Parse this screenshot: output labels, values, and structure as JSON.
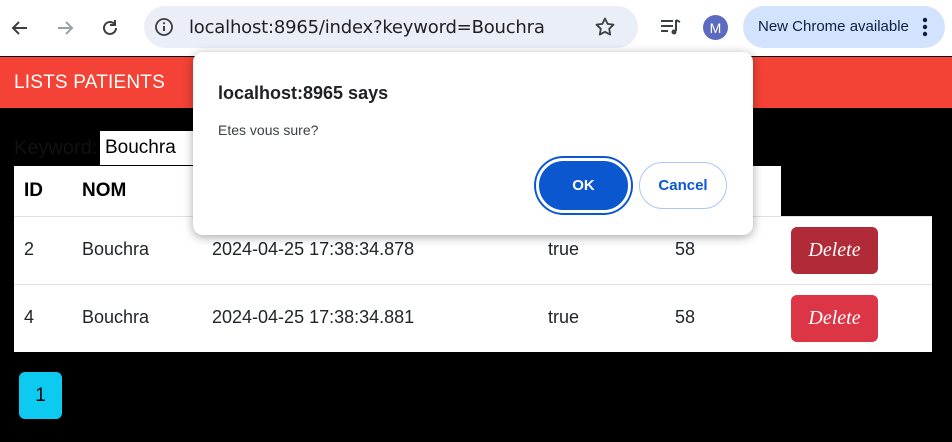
{
  "browser": {
    "url": "localhost:8965/index?keyword=Bouchra",
    "profile_initial": "M",
    "update_label": "New Chrome available"
  },
  "app": {
    "title": "LISTS PATIENTS"
  },
  "search": {
    "label": "Keyword:",
    "value": "Bouchra"
  },
  "table": {
    "headers": [
      "ID",
      "NOM"
    ],
    "rows": [
      {
        "id": "2",
        "nom": "Bouchra",
        "date": "2024-04-25 17:38:34.878",
        "malade": "true",
        "score": "58",
        "action": "Delete"
      },
      {
        "id": "4",
        "nom": "Bouchra",
        "date": "2024-04-25 17:38:34.881",
        "malade": "true",
        "score": "58",
        "action": "Delete"
      }
    ]
  },
  "pagination": {
    "pages": [
      "1"
    ]
  },
  "dialog": {
    "title": "localhost:8965 says",
    "message": "Etes vous sure?",
    "ok_label": "OK",
    "cancel_label": "Cancel"
  },
  "colors": {
    "header_red": "#f44336",
    "delete_red": "#dc3545",
    "page_cyan": "#0dcaf0",
    "dialog_blue": "#0b57d0"
  }
}
